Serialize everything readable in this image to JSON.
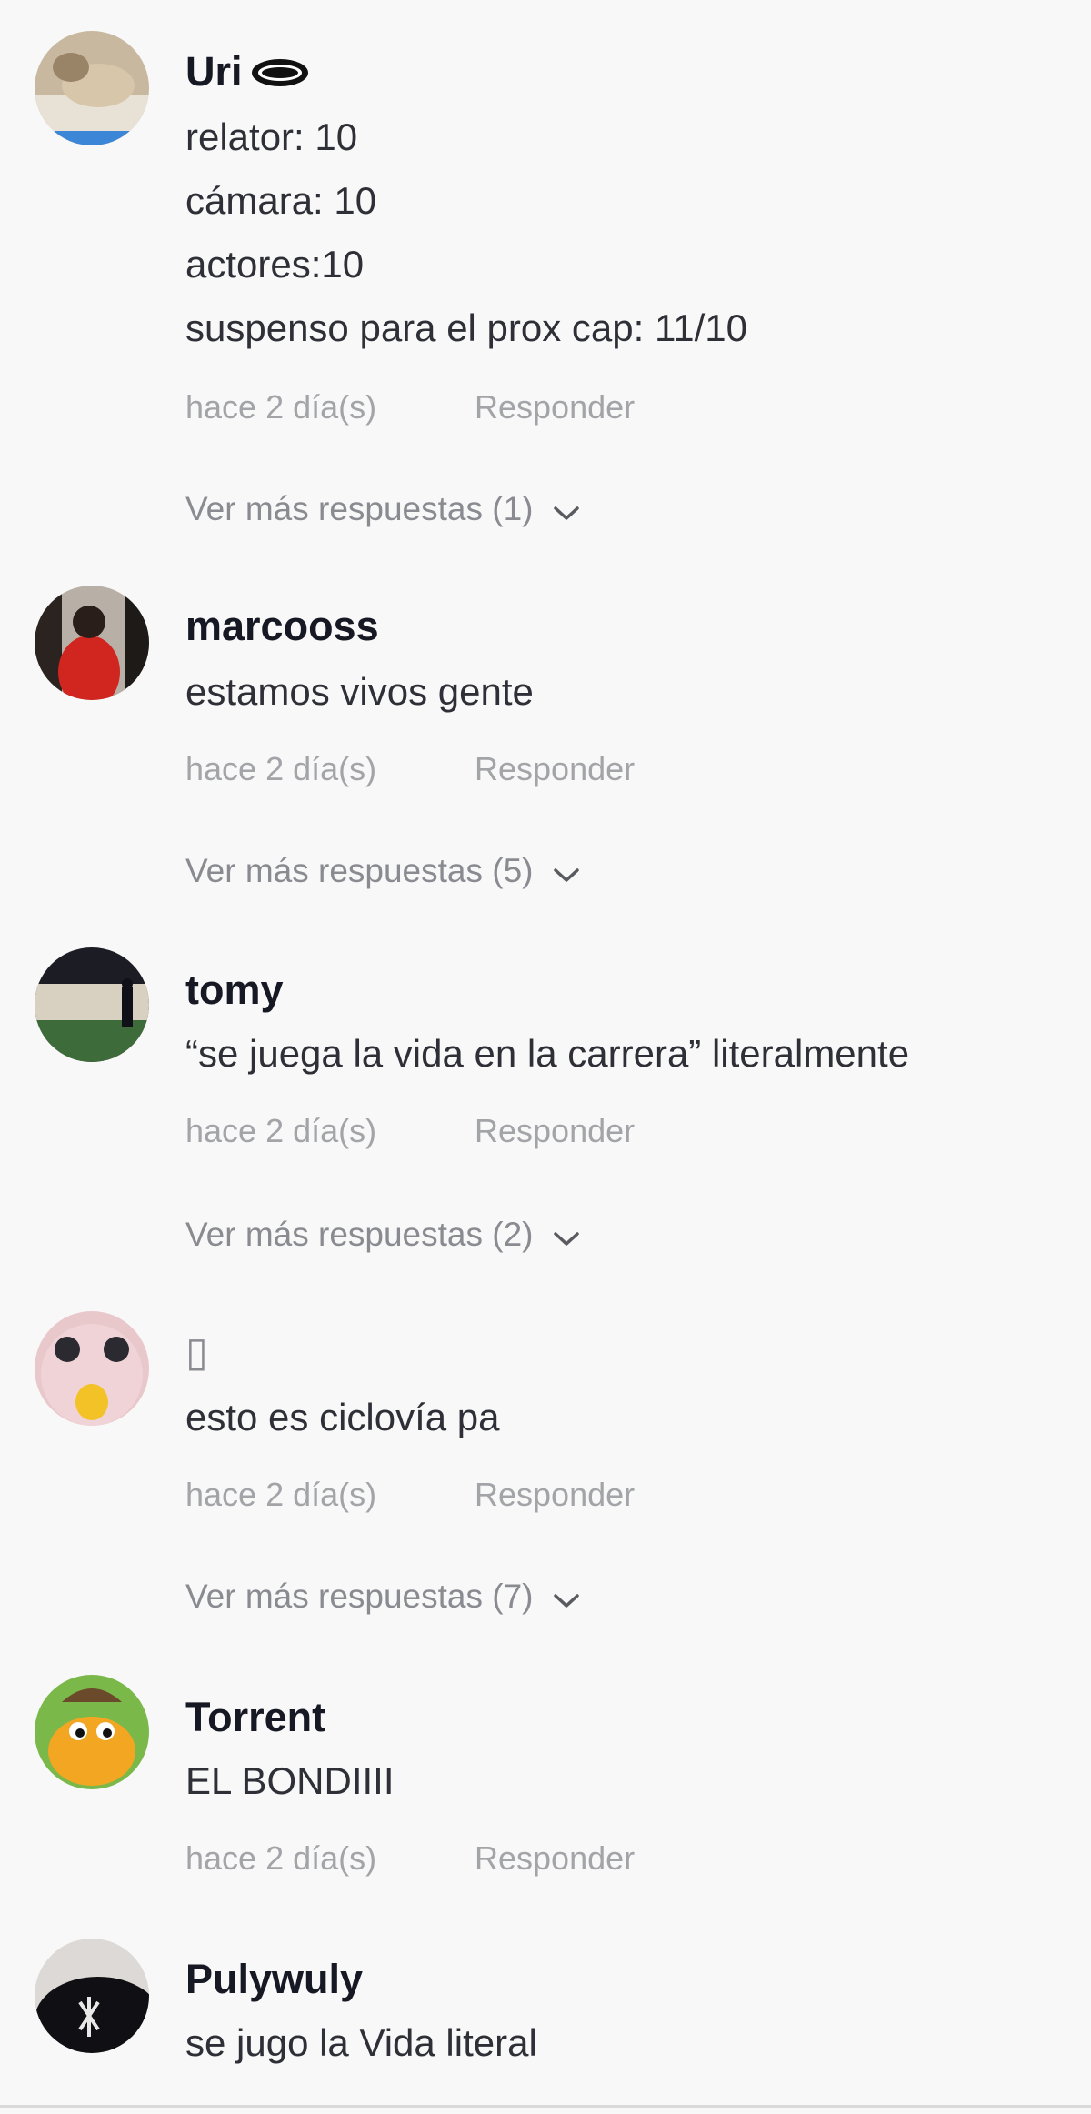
{
  "comments": [
    {
      "username": "Uri",
      "text_lines": [
        "relator: 10",
        "cámara: 10",
        "actores:10",
        "suspenso para el prox cap: 11/10"
      ],
      "time": "hace 2 día(s)",
      "reply_label": "Responder",
      "more_replies": "Ver más respuestas (1)"
    },
    {
      "username": "marcooss",
      "text_lines": [
        "estamos vivos gente"
      ],
      "time": "hace 2 día(s)",
      "reply_label": "Responder",
      "more_replies": "Ver más respuestas (5)"
    },
    {
      "username": "tomy",
      "text_lines": [
        "“se juega la vida en la carrera” literalmente"
      ],
      "time": "hace 2 día(s)",
      "reply_label": "Responder",
      "more_replies": "Ver más respuestas (2)"
    },
    {
      "username": "▯",
      "text_lines": [
        "esto es ciclovía pa"
      ],
      "time": "hace 2 día(s)",
      "reply_label": "Responder",
      "more_replies": "Ver más respuestas (7)"
    },
    {
      "username": "Torrent",
      "text_lines": [
        "EL BONDIIII"
      ],
      "time": "hace 2 día(s)",
      "reply_label": "Responder"
    },
    {
      "username": "Pulywuly",
      "text_lines": [
        "se jugo la Vida literal"
      ]
    }
  ]
}
